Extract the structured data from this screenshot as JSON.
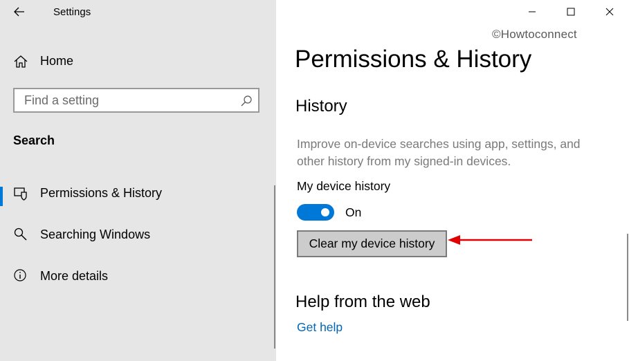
{
  "window": {
    "title": "Settings",
    "controls": {
      "minimize_icon": "minimize-icon",
      "maximize_icon": "maximize-icon",
      "close_icon": "close-icon"
    }
  },
  "sidebar": {
    "home_label": "Home",
    "search_placeholder": "Find a setting",
    "section_header": "Search",
    "items": [
      {
        "label": "Permissions & History",
        "icon": "shield-icon",
        "selected": true
      },
      {
        "label": "Searching Windows",
        "icon": "search-icon",
        "selected": false
      },
      {
        "label": "More details",
        "icon": "info-icon",
        "selected": false
      }
    ]
  },
  "main": {
    "watermark": "©Howtoconnect",
    "page_title": "Permissions & History",
    "history": {
      "heading": "History",
      "description": "Improve on-device searches using app, settings, and other history from my signed-in devices.",
      "toggle_label": "My device history",
      "toggle_state": "On",
      "toggle_on": true,
      "clear_button": "Clear my device history"
    },
    "help": {
      "heading": "Help from the web",
      "link": "Get help"
    }
  },
  "colors": {
    "sidebar_bg": "#e6e6e6",
    "accent": "#0078d7",
    "link": "#0066b4",
    "annotation_arrow": "#e00000",
    "description_text": "#7a7a7a"
  }
}
